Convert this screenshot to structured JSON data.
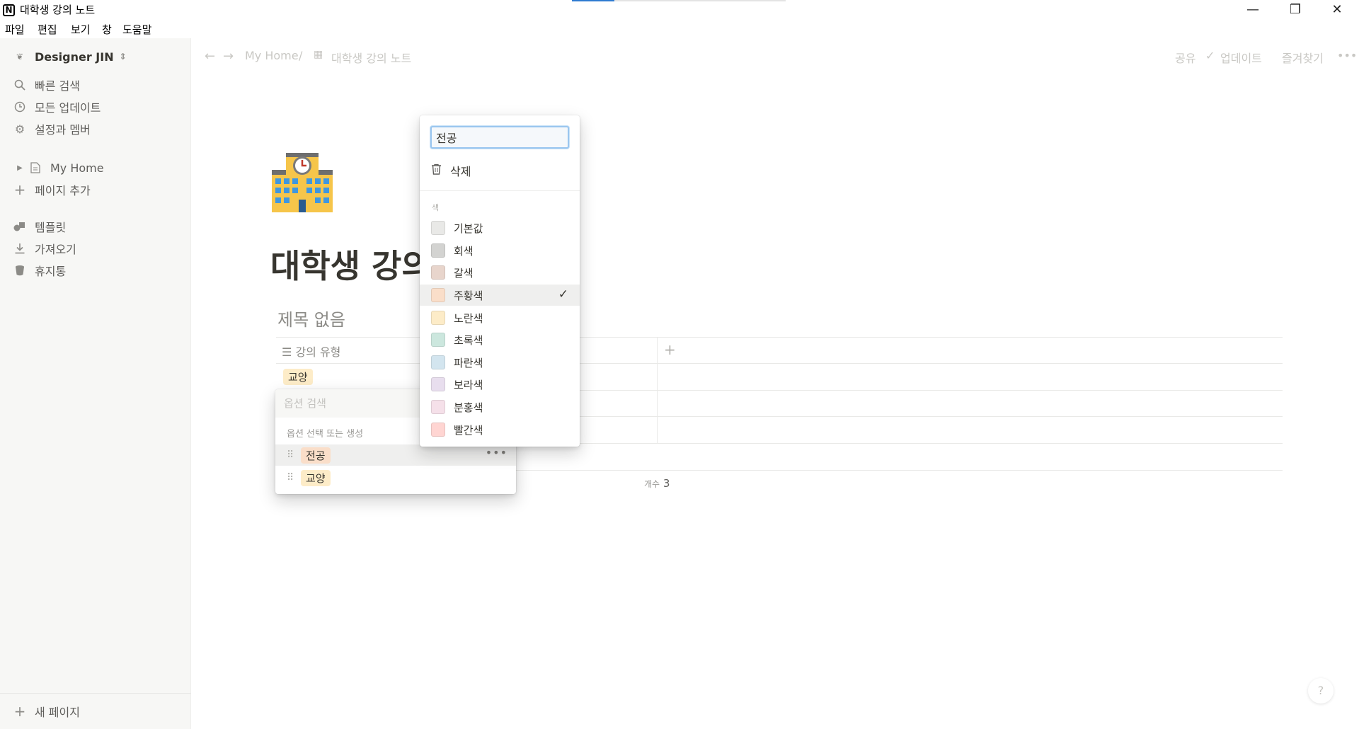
{
  "window": {
    "title": "대학생 강의 노트",
    "controls": {
      "minimize": "—",
      "maximize": "❐",
      "close": "✕"
    }
  },
  "menubar": [
    "파일",
    "편집",
    "보기",
    "창",
    "도움말"
  ],
  "sidebar": {
    "workspace": "Designer JIN",
    "items": [
      {
        "label": "빠른 검색",
        "icon": "search-icon"
      },
      {
        "label": "모든 업데이트",
        "icon": "clock-icon"
      },
      {
        "label": "설정과 멤버",
        "icon": "gear-icon"
      },
      {
        "label": "My Home",
        "icon": "page-icon"
      },
      {
        "label": "페이지 추가",
        "icon": "plus-icon"
      },
      {
        "label": "템플릿",
        "icon": "shapes-icon"
      },
      {
        "label": "가져오기",
        "icon": "download-icon"
      },
      {
        "label": "휴지통",
        "icon": "trash-icon"
      }
    ],
    "new_page": "새 페이지"
  },
  "topbar": {
    "breadcrumb": [
      "My Home",
      "대학생 강의 노트"
    ],
    "separator": "/",
    "share": "공유",
    "updates": "업데이트",
    "favorites": "즐겨찾기",
    "more": "•••"
  },
  "page": {
    "icon": "school-building-icon",
    "title": "대학생 강의 노트"
  },
  "database": {
    "title": "제목 없음",
    "column_header": "강의 유형",
    "add_column": "+",
    "rows": [
      {
        "tag": "교양",
        "tag_color": "#fdecc8"
      },
      {
        "tag": "",
        "tag_color": ""
      },
      {
        "tag": "",
        "tag_color": ""
      }
    ],
    "count_label": "개수",
    "count_value": "3"
  },
  "option_popup": {
    "search_placeholder": "옵션 검색",
    "hint": "옵션 선택 또는 생성",
    "options": [
      {
        "label": "전공",
        "color": "#fadec9"
      },
      {
        "label": "교양",
        "color": "#fdecc8"
      }
    ],
    "more": "•••"
  },
  "color_menu": {
    "name_value": "전공",
    "delete_label": "삭제",
    "section_label": "색",
    "colors": [
      {
        "label": "기본값",
        "hex": "#e9e9e7"
      },
      {
        "label": "회색",
        "hex": "#d3d3d1"
      },
      {
        "label": "갈색",
        "hex": "#e8d5cc"
      },
      {
        "label": "주황색",
        "hex": "#fadec9",
        "selected": true
      },
      {
        "label": "노란색",
        "hex": "#fdecc8"
      },
      {
        "label": "초록색",
        "hex": "#cce7de"
      },
      {
        "label": "파란색",
        "hex": "#d3e5ef"
      },
      {
        "label": "보라색",
        "hex": "#e8deee"
      },
      {
        "label": "분홍색",
        "hex": "#f5e0e9"
      },
      {
        "label": "빨간색",
        "hex": "#ffd5d2"
      }
    ],
    "check": "✓"
  },
  "help": "?"
}
